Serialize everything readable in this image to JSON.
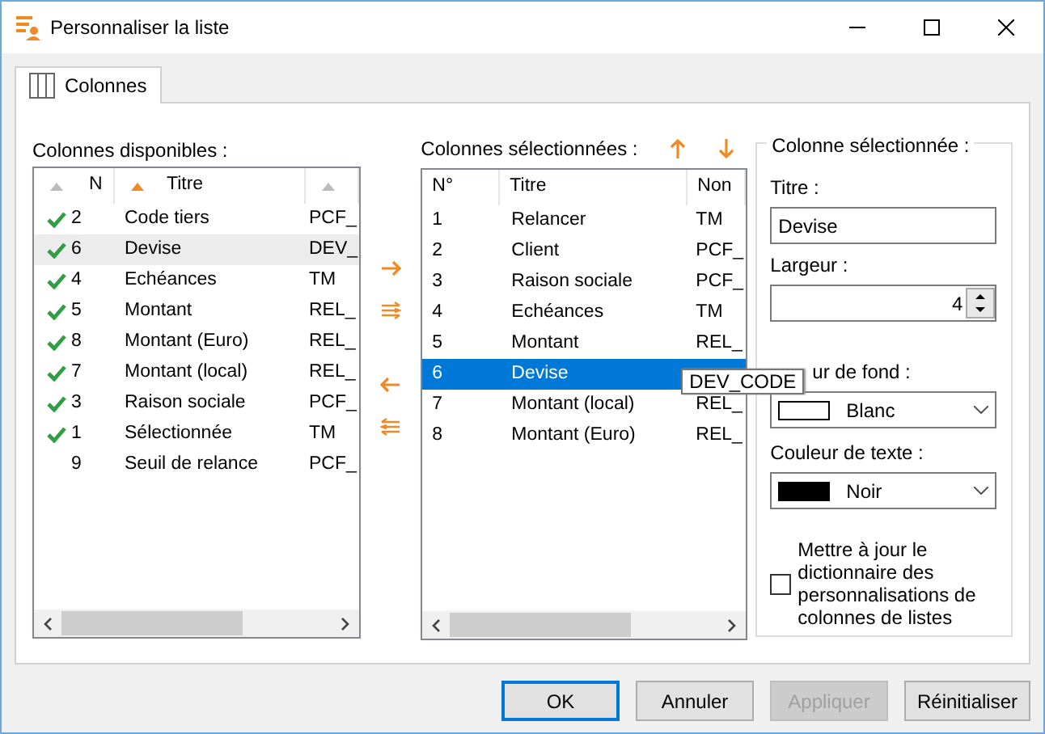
{
  "window": {
    "title": "Personnaliser la liste"
  },
  "tabs": [
    {
      "label": "Colonnes",
      "selected": true
    }
  ],
  "available": {
    "label": "Colonnes disponibles :",
    "columns": [
      {
        "sorted": false,
        "label": "N"
      },
      {
        "sorted": true,
        "label": "Titre"
      },
      {
        "sorted": false
      }
    ],
    "rows": [
      {
        "checked": true,
        "selected": false,
        "n": "2",
        "title": "Code tiers",
        "name": "PCF_"
      },
      {
        "checked": true,
        "selected": true,
        "n": "6",
        "title": "Devise",
        "name": "DEV_"
      },
      {
        "checked": true,
        "selected": false,
        "n": "4",
        "title": "Echéances",
        "name": "TM"
      },
      {
        "checked": true,
        "selected": false,
        "n": "5",
        "title": "Montant",
        "name": "REL_"
      },
      {
        "checked": true,
        "selected": false,
        "n": "8",
        "title": "Montant (Euro)",
        "name": "REL_"
      },
      {
        "checked": true,
        "selected": false,
        "n": "7",
        "title": "Montant (local)",
        "name": "REL_"
      },
      {
        "checked": true,
        "selected": false,
        "n": "3",
        "title": "Raison sociale",
        "name": "PCF_"
      },
      {
        "checked": true,
        "selected": false,
        "n": "1",
        "title": "Sélectionnée",
        "name": "TM"
      },
      {
        "checked": false,
        "selected": false,
        "n": "9",
        "title": "Seuil de relance",
        "name": "PCF_"
      }
    ]
  },
  "transfer_buttons": [
    {
      "kind": "add"
    },
    {
      "kind": "add_all"
    },
    {
      "kind": "remove"
    },
    {
      "kind": "remove_all"
    }
  ],
  "selected_columns": {
    "label": "Colonnes sélectionnées :",
    "columns": [
      "N°",
      "Titre",
      "Non"
    ],
    "rows": [
      {
        "selected": false,
        "n": "1",
        "title": "Relancer",
        "name": "TM"
      },
      {
        "selected": false,
        "n": "2",
        "title": "Client",
        "name": "PCF_"
      },
      {
        "selected": false,
        "n": "3",
        "title": "Raison sociale",
        "name": "PCF_"
      },
      {
        "selected": false,
        "n": "4",
        "title": "Echéances",
        "name": "TM"
      },
      {
        "selected": false,
        "n": "5",
        "title": "Montant",
        "name": "REL_"
      },
      {
        "selected": true,
        "n": "6",
        "title": "Devise"
      },
      {
        "selected": false,
        "n": "7",
        "title": "Montant (local)",
        "name": "REL_"
      },
      {
        "selected": false,
        "n": "8",
        "title": "Montant (Euro)",
        "name": "REL_"
      }
    ]
  },
  "tooltip": "DEV_CODE",
  "column_details": {
    "legend": "Colonne sélectionnée :",
    "title_label": "Titre :",
    "title_value": "Devise",
    "width_label": "Largeur :",
    "width_value": "4",
    "background_label": "ur de fond :",
    "background": {
      "color": "#ffffff",
      "label": "Blanc"
    },
    "text_color_label": "Couleur de texte :",
    "text_color": {
      "color": "#000000",
      "label": "Noir"
    },
    "update_dictionary": {
      "checked": false,
      "label": "Mettre à jour le dictionnaire des personnalisations de colonnes de listes"
    }
  },
  "buttons": [
    {
      "label": "OK",
      "default": true,
      "disabled": false
    },
    {
      "label": "Annuler",
      "default": false,
      "disabled": false
    },
    {
      "label": "Appliquer",
      "default": false,
      "disabled": true
    },
    {
      "label": "Réinitialiser",
      "default": false,
      "disabled": false
    }
  ]
}
